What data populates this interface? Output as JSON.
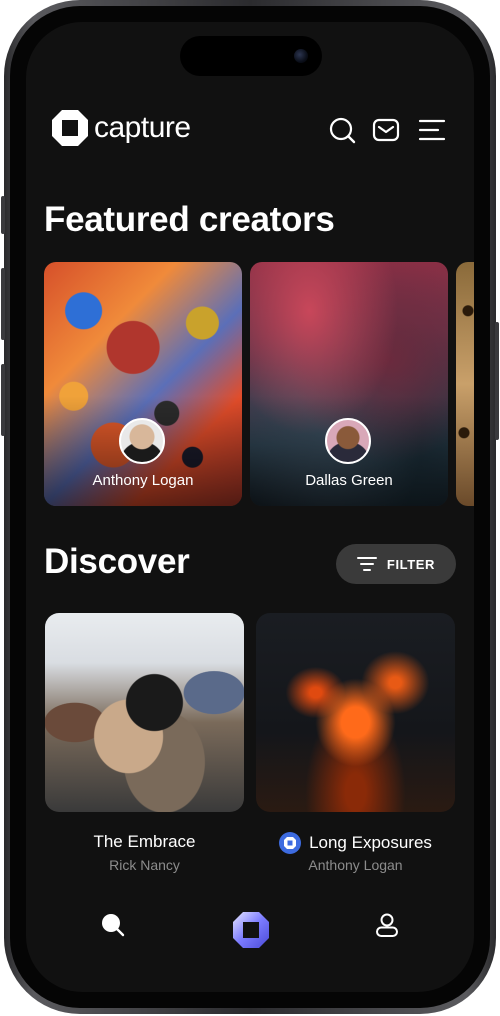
{
  "app": {
    "brand": "capture",
    "colors": {
      "background": "#111111",
      "accent": "#3d6be0",
      "filter_bg": "#3a3a3a",
      "muted_text": "#8c8c8c"
    }
  },
  "header": {
    "icons": [
      "search-icon",
      "mail-icon",
      "menu-icon"
    ]
  },
  "featured": {
    "title": "Featured creators",
    "creators": [
      {
        "name": "Anthony Logan"
      },
      {
        "name": "Dallas Green"
      }
    ]
  },
  "discover": {
    "title": "Discover",
    "filter_label": "FILTER",
    "items": [
      {
        "title": "The Embrace",
        "author": "Rick Nancy",
        "badge": null
      },
      {
        "title": "Long Exposures",
        "author": "Anthony Logan",
        "badge": "capture-badge-icon"
      }
    ]
  },
  "bottom_nav": {
    "icons": [
      "search-icon",
      "capture-logo-icon",
      "profile-icon"
    ]
  }
}
